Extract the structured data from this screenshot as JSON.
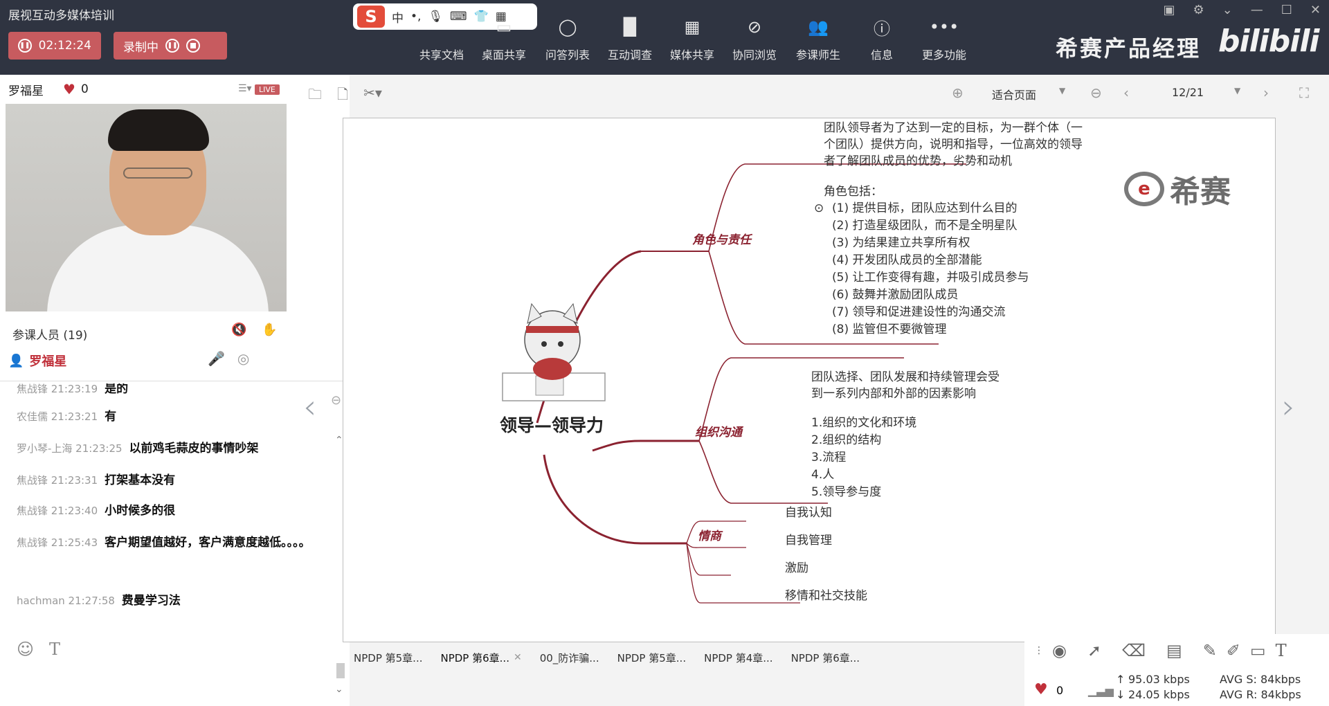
{
  "app": {
    "title": "展视互动多媒体培训"
  },
  "session": {
    "timer": "02:12:24",
    "record_label": "录制中"
  },
  "ime": {
    "lang": "中"
  },
  "toolbar": {
    "items": [
      {
        "label": "共享文档",
        "icon": "document-icon"
      },
      {
        "label": "桌面共享",
        "icon": "desktop-icon"
      },
      {
        "label": "问答列表",
        "icon": "chat-bubble-icon"
      },
      {
        "label": "互动调查",
        "icon": "bar-chart-icon"
      },
      {
        "label": "媒体共享",
        "icon": "film-icon"
      },
      {
        "label": "协同浏览",
        "icon": "compass-icon"
      },
      {
        "label": "参课师生",
        "icon": "users-icon"
      },
      {
        "label": "信息",
        "icon": "info-icon"
      },
      {
        "label": "更多功能",
        "icon": "more-icon"
      }
    ]
  },
  "brand": {
    "text": "希赛产品经理",
    "bili": "bilibili"
  },
  "teacher": {
    "name": "罗福星",
    "likes": "0",
    "live": "LIVE"
  },
  "participants": {
    "label": "参课人员 (19)",
    "me": "罗福星"
  },
  "chat": {
    "messages": [
      {
        "who": "焦战锋 21:23:19",
        "text": "是的"
      },
      {
        "who": "农佳儒 21:23:21",
        "text": "有"
      },
      {
        "who": "罗小琴-上海 21:23:25",
        "text": "以前鸡毛蒜皮的事情吵架"
      },
      {
        "who": "焦战锋 21:23:31",
        "text": "打架基本没有"
      },
      {
        "who": "焦战锋 21:23:40",
        "text": "小时候多的很"
      },
      {
        "who": "焦战锋 21:25:43",
        "text": "客户期望值越好，客户满意度越低。。。。"
      },
      {
        "who": "hachman 21:27:58",
        "text": "费曼学习法"
      }
    ]
  },
  "viewer": {
    "fit": "适合页面",
    "page": "12/21"
  },
  "mindmap": {
    "center": "领导—领导力",
    "branches": {
      "role": "角色与责任",
      "org": "组织沟通",
      "eq": "情商"
    },
    "role_definition": [
      "团队领导者为了达到一定的目标，为一群个体（一",
      "个团队）提供方向，说明和指导，一位高效的领导",
      "者了解团队成员的优势，劣势和动机"
    ],
    "role_heading": "角色包括：",
    "role_items": [
      "(1) 提供目标，团队应达到什么目的",
      "(2) 打造星级团队，而不是全明星队",
      "(3) 为结果建立共享所有权",
      "(4) 开发团队成员的全部潜能",
      "(5) 让工作变得有趣，并吸引成员参与",
      "(6) 鼓舞并激励团队成员",
      "(7) 领导和促进建设性的沟通交流",
      "(8) 监管但不要微管理"
    ],
    "org_definition": [
      "团队选择、团队发展和持续管理会受",
      "到一系列内部和外部的因素影响"
    ],
    "org_items": [
      "1.组织的文化和环境",
      "2.组织的结构",
      "3.流程",
      "4.人",
      "5.领导参与度"
    ],
    "eq_items": [
      "自我认知",
      "自我管理",
      "激励",
      "移情和社交技能"
    ],
    "logo_text": "希赛"
  },
  "doc_tabs": [
    {
      "label": "NPDP 第5章..."
    },
    {
      "label": "NPDP 第6章..."
    },
    {
      "label": "00_防诈骗..."
    },
    {
      "label": "NPDP 第5章..."
    },
    {
      "label": "NPDP 第4章..."
    },
    {
      "label": "NPDP 第6章..."
    }
  ],
  "status": {
    "likes": "0",
    "up": "95.03 kbps",
    "down": "24.05 kbps",
    "avg_s": "AVG S: 84kbps",
    "avg_r": "AVG R: 84kbps"
  },
  "colors": {
    "accent": "#c75b5f",
    "branch": "#8b2230",
    "topbar": "#2f3441"
  }
}
